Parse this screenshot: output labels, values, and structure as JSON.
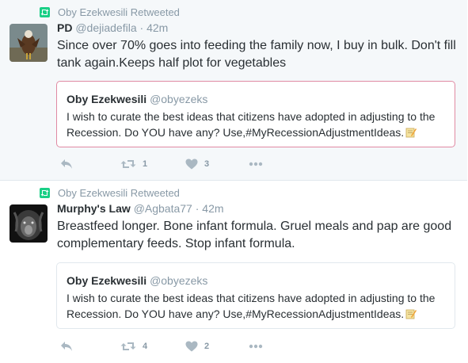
{
  "tweets": [
    {
      "retweeted_by": "Oby Ezekwesili Retweeted",
      "name": "PD",
      "handle": "@dejiadefila",
      "dot": "·",
      "time": "42m",
      "text": "Since over 70% goes into feeding the family now, I buy in bulk. Don't fill tank again.Keeps half plot for vegetables",
      "quote": {
        "name": "Oby Ezekwesili",
        "handle": "@obyezeks",
        "text": "I wish to curate the best ideas that citizens have adopted in adjusting to the Recession. Do YOU have any? Use,#MyRecessionAdjustmentIdeas."
      },
      "retweets": "1",
      "likes": "3"
    },
    {
      "retweeted_by": "Oby Ezekwesili Retweeted",
      "name": "Murphy's Law",
      "handle": "@Agbata77",
      "dot": "·",
      "time": "42m",
      "text": "Breastfeed longer. Bone infant formula. Gruel meals and pap are good complementary feeds. Stop infant formula.",
      "quote": {
        "name": "Oby Ezekwesili",
        "handle": "@obyezeks",
        "text": "I wish to curate the best ideas that citizens have adopted in adjusting to the Recession. Do YOU have any? Use,#MyRecessionAdjustmentIdeas."
      },
      "retweets": "4",
      "likes": "2"
    }
  ],
  "colors": {
    "accent": "#19cf86",
    "muted": "#8899a6",
    "border": "#e1e8ed",
    "highlight_border": "#e08aa3"
  },
  "icons": [
    "retweet-badge-icon",
    "reply-icon",
    "retweet-icon",
    "like-icon",
    "more-icon",
    "memo-emoji-icon"
  ]
}
